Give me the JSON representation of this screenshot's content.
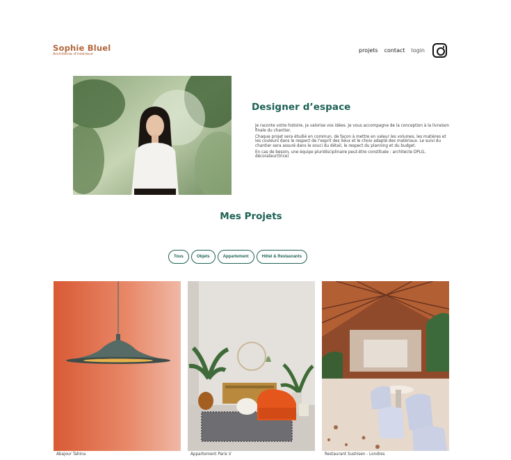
{
  "header": {
    "brand_name": "Sophie Bluel",
    "brand_subtitle": "Architecte d'intérieur",
    "nav": {
      "projects": "projets",
      "contact": "contact",
      "login": "login"
    },
    "instagram_icon": "instagram-icon"
  },
  "intro": {
    "title": "Designer d’espace",
    "paragraphs": [
      "Je raconte votre histoire, je valorise vos idées. Je vous accompagne de la conception à la livraison finale du chantier.",
      "Chaque projet sera étudié en commun, de façon à mettre en valeur les volumes, les matières et les couleurs dans le respect de l’esprit des lieux et le choix adapté des matériaux. Le suivi du chantier sera assuré dans le souci du détail, le respect du planning et du budget.",
      "En cas de besoin, une équipe pluridisciplinaire peut-être constituée : architecte DPLG, décorateur(trice)"
    ]
  },
  "projects": {
    "title": "Mes Projets",
    "filters": [
      "Tous",
      "Objets",
      "Appartement",
      "Hôtel & Restaurants"
    ],
    "items": [
      {
        "caption": "Abajour Tahina"
      },
      {
        "caption": "Appartement Paris V"
      },
      {
        "caption": "Restaurant Sushisen - Londres"
      }
    ]
  },
  "colors": {
    "brand": "#b1663c",
    "accent": "#1d6154"
  }
}
